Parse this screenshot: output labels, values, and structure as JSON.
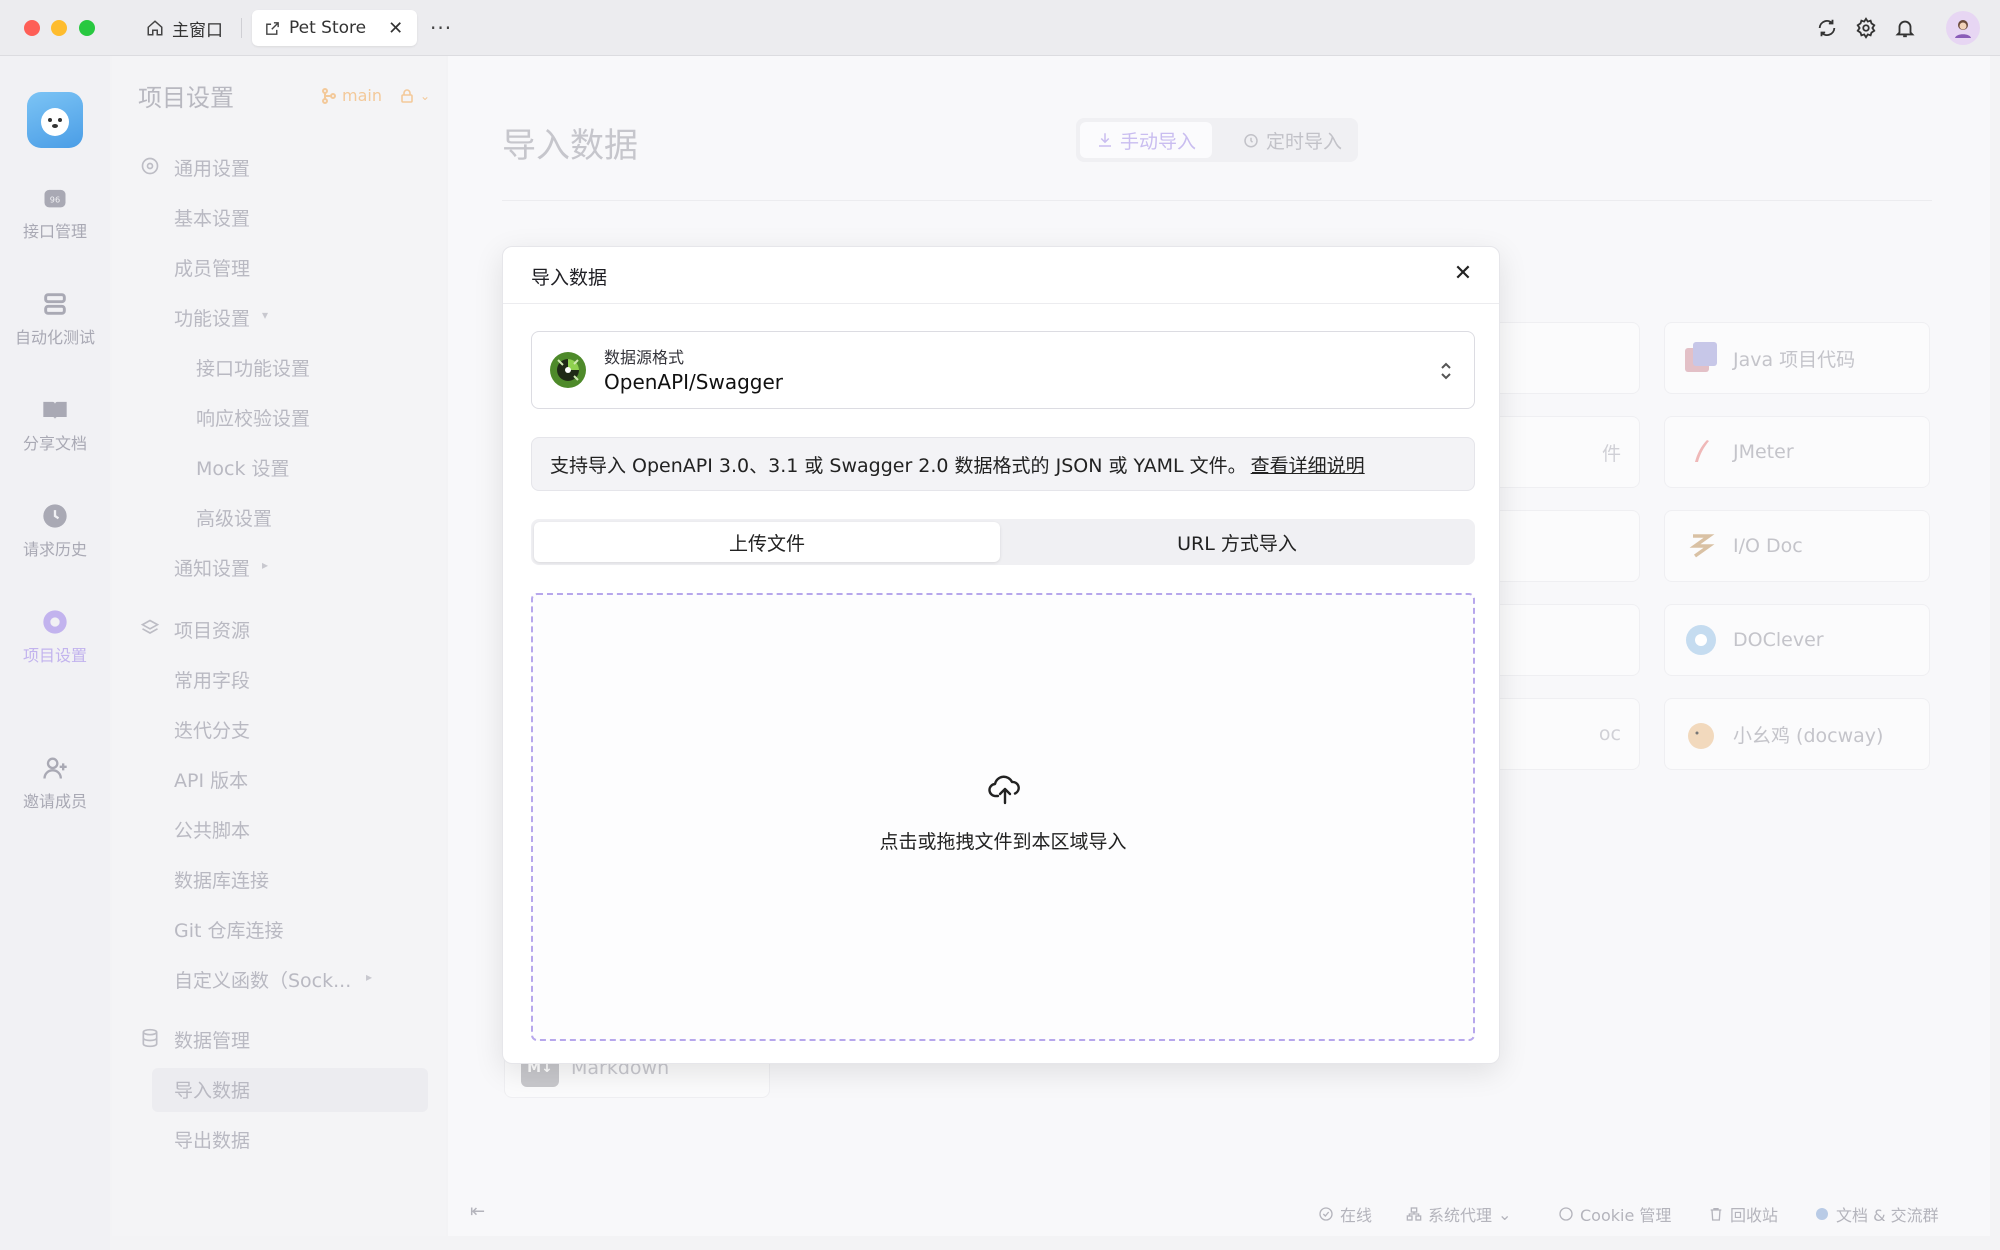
{
  "titlebar": {
    "home_tab": "主窗口",
    "active_tab": "Pet Store",
    "more": "···"
  },
  "rail": {
    "items": [
      {
        "label": "接口管理"
      },
      {
        "label": "自动化测试"
      },
      {
        "label": "分享文档"
      },
      {
        "label": "请求历史"
      },
      {
        "label": "项目设置"
      },
      {
        "label": "邀请成员"
      }
    ]
  },
  "sidebar": {
    "title": "项目设置",
    "branch": "main",
    "items": [
      "通用设置",
      "基本设置",
      "成员管理",
      "功能设置",
      "接口功能设置",
      "响应校验设置",
      "Mock 设置",
      "高级设置",
      "通知设置",
      "项目资源",
      "常用字段",
      "迭代分支",
      "API 版本",
      "公共脚本",
      "数据库连接",
      "Git 仓库连接",
      "自定义函数（Sock...",
      "数据管理",
      "导入数据",
      "导出数据"
    ]
  },
  "main": {
    "page_title": "导入数据",
    "seg_manual": "手动导入",
    "seg_scheduled": "定时导入",
    "cards_right": [
      "Java 项目代码",
      "JMeter",
      "I/O Doc",
      "DOClever",
      "小幺鸡 (docway)"
    ],
    "cards_partial": [
      "件",
      "oc"
    ],
    "markdown": "Markdown"
  },
  "status": {
    "online": "在线",
    "proxy": "系统代理",
    "cookie": "Cookie 管理",
    "trash": "回收站",
    "docs": "文档 & 交流群"
  },
  "modal": {
    "title": "导入数据",
    "format_label": "数据源格式",
    "format_value": "OpenAPI/Swagger",
    "info_text": "支持导入 OpenAPI 3.0、3.1 或 Swagger 2.0 数据格式的 JSON 或 YAML 文件。",
    "info_link": "查看详细说明",
    "tab_upload": "上传文件",
    "tab_url": "URL 方式导入",
    "dropzone_text": "点击或拖拽文件到本区域导入"
  }
}
